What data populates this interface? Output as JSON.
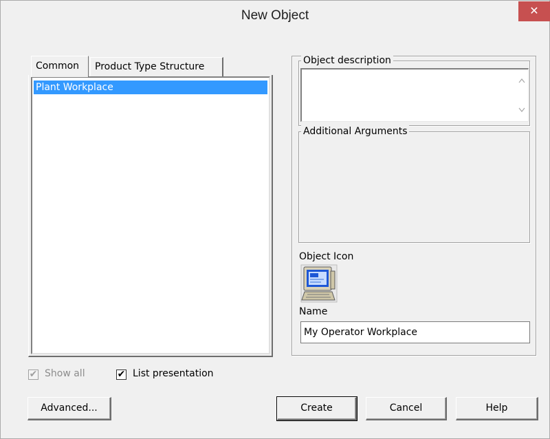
{
  "window": {
    "title": "New Object",
    "close_label": "✕"
  },
  "tabs": [
    {
      "label": "Common",
      "active": true
    },
    {
      "label": "Product Type Structure",
      "active": false
    }
  ],
  "object_list": {
    "items": [
      {
        "label": "Plant Workplace",
        "selected": true
      }
    ]
  },
  "description": {
    "label": "Object description",
    "value": ""
  },
  "arguments": {
    "label": "Additional Arguments"
  },
  "object_icon": {
    "label": "Object Icon",
    "icon": "computer-workstation-icon"
  },
  "name_field": {
    "label": "Name",
    "value": "My Operator Workplace"
  },
  "options": {
    "show_all": {
      "label": "Show all",
      "checked": true,
      "enabled": false
    },
    "list_presentation": {
      "label": "List presentation",
      "checked": true,
      "enabled": true
    }
  },
  "buttons": {
    "advanced": "Advanced...",
    "create": "Create",
    "cancel": "Cancel",
    "help": "Help"
  },
  "colors": {
    "selection": "#3399ff",
    "close_button": "#c75050",
    "dialog_bg": "#f0f0f0"
  }
}
